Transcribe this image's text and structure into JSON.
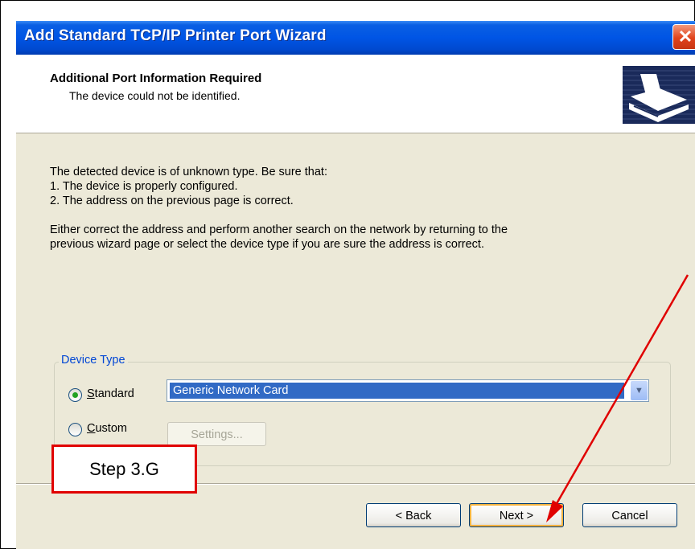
{
  "window": {
    "title": "Add Standard TCP/IP Printer Port Wizard",
    "close_label": "✕"
  },
  "header": {
    "title": "Additional Port Information Required",
    "subtitle": "The device could not be identified.",
    "icon": "printer-port-icon"
  },
  "body": {
    "lines": [
      "The detected device is of unknown type.  Be sure that:",
      "1. The device is properly configured.",
      "2.  The address on the previous page is correct.",
      "Either correct the address and perform another search on the network by returning to the",
      "previous wizard page or select the device type if you are sure the address is correct."
    ]
  },
  "device_type": {
    "legend": "Device Type",
    "standard_label": "Standard",
    "standard_mnemonic": "S",
    "standard_rest": "tandard",
    "custom_label": "Custom",
    "custom_mnemonic": "C",
    "custom_rest": "ustom",
    "selected": "Standard",
    "standard_value": "Generic Network Card",
    "settings_button": "Settings..."
  },
  "buttons": {
    "back_label": "< Back",
    "next_label": "Next >",
    "cancel_label": "Cancel"
  },
  "annotation": {
    "step_label": "Step 3.G",
    "arrow_color": "#e00000"
  },
  "colors": {
    "title_bar": "#0055e5",
    "dialog_bg": "#ece9d8",
    "selection": "#316ac5",
    "legend_text": "#0046d5"
  }
}
